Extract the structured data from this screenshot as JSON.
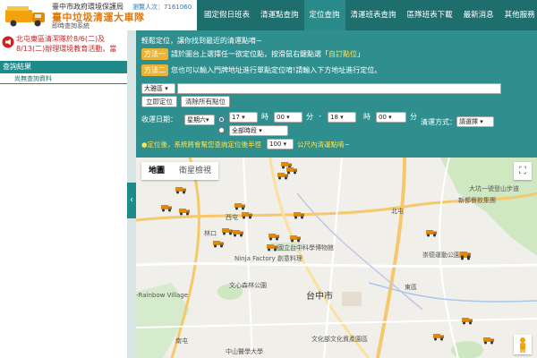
{
  "header": {
    "org": "臺中市政府環境保護局",
    "title": "臺中垃圾清運大車隊",
    "subtitle": "即時查詢系統",
    "visitor_label": "瀏覽人次：",
    "visitor_count": "7161060",
    "nav": [
      {
        "label": "國定假日班表",
        "active": false
      },
      {
        "label": "清運點查詢",
        "active": false
      },
      {
        "label": "定位查詢",
        "active": true
      },
      {
        "label": "清運班表查詢",
        "active": false
      },
      {
        "label": "區隊班表下載",
        "active": false
      },
      {
        "label": "最新消息",
        "active": false
      },
      {
        "label": "其他服務",
        "active": false
      }
    ]
  },
  "sidebar": {
    "announcement_line1": "北屯東區清潔隊於8/6(二)及",
    "announcement_line2": "8/13(二)辦理環境教育活動，當",
    "result_title": "查詢結果",
    "result_empty": "尚無查詢資料",
    "collapse_glyph": "‹"
  },
  "panel": {
    "intro": "輕鬆定位，讓你找到最近的清運點唷~",
    "method1_tag": "方法一",
    "method1_text": "請於圖台上選擇任一欲定位點，按滑鼠右鍵點選「",
    "method1_highlight": "自訂點位",
    "method1_end": "」",
    "method2_tag": "方法二",
    "method2_text": "您也可以輸入門牌地址進行單點定位唷!請輸入下方地址進行定位。",
    "district": "大雅區",
    "locate_button": "立即定位",
    "clear_button": "清除所有點位",
    "date_label": "收運日期：",
    "weekday": "星期六",
    "hour_from": "17",
    "hour_unit": "時",
    "min_from": "00",
    "min_unit": "分",
    "range_sep": "-",
    "hour_to": "18",
    "min_to": "00",
    "method_label": "清運方式：",
    "method_select": "請選擇",
    "all_periods": "全部時段",
    "radius_prefix": "●定位後，系統將會幫您查詢定位後半徑",
    "radius_value": "100",
    "radius_suffix": "公尺內清運點唷~"
  },
  "map": {
    "type_map": "地圖",
    "type_satellite": "衛星檢視",
    "fullscreen_glyph": "⛶",
    "labels": {
      "city": "台中市",
      "xitun": "西屯",
      "nantun": "南屯",
      "east": "東區",
      "beitun": "北屯",
      "ninja": "Ninja Factory 創意料理",
      "culture": "文心森林公園",
      "rainbow": "-Rainbow Village",
      "hospital": "中山醫學大學",
      "park": "大坑一號登山步道",
      "food": "新都餐飲集團",
      "school": "國立台中科學博物館",
      "park2": "崇德運動公園",
      "lin": "林口",
      "nature": "文化部文化資產園區"
    }
  },
  "colors": {
    "header_bg": "#1f6e6e",
    "panel_bg": "#2f8f8f",
    "accent_orange": "#e07a10",
    "method_tag": "#e8b43a",
    "alert_red": "#cc2222"
  }
}
